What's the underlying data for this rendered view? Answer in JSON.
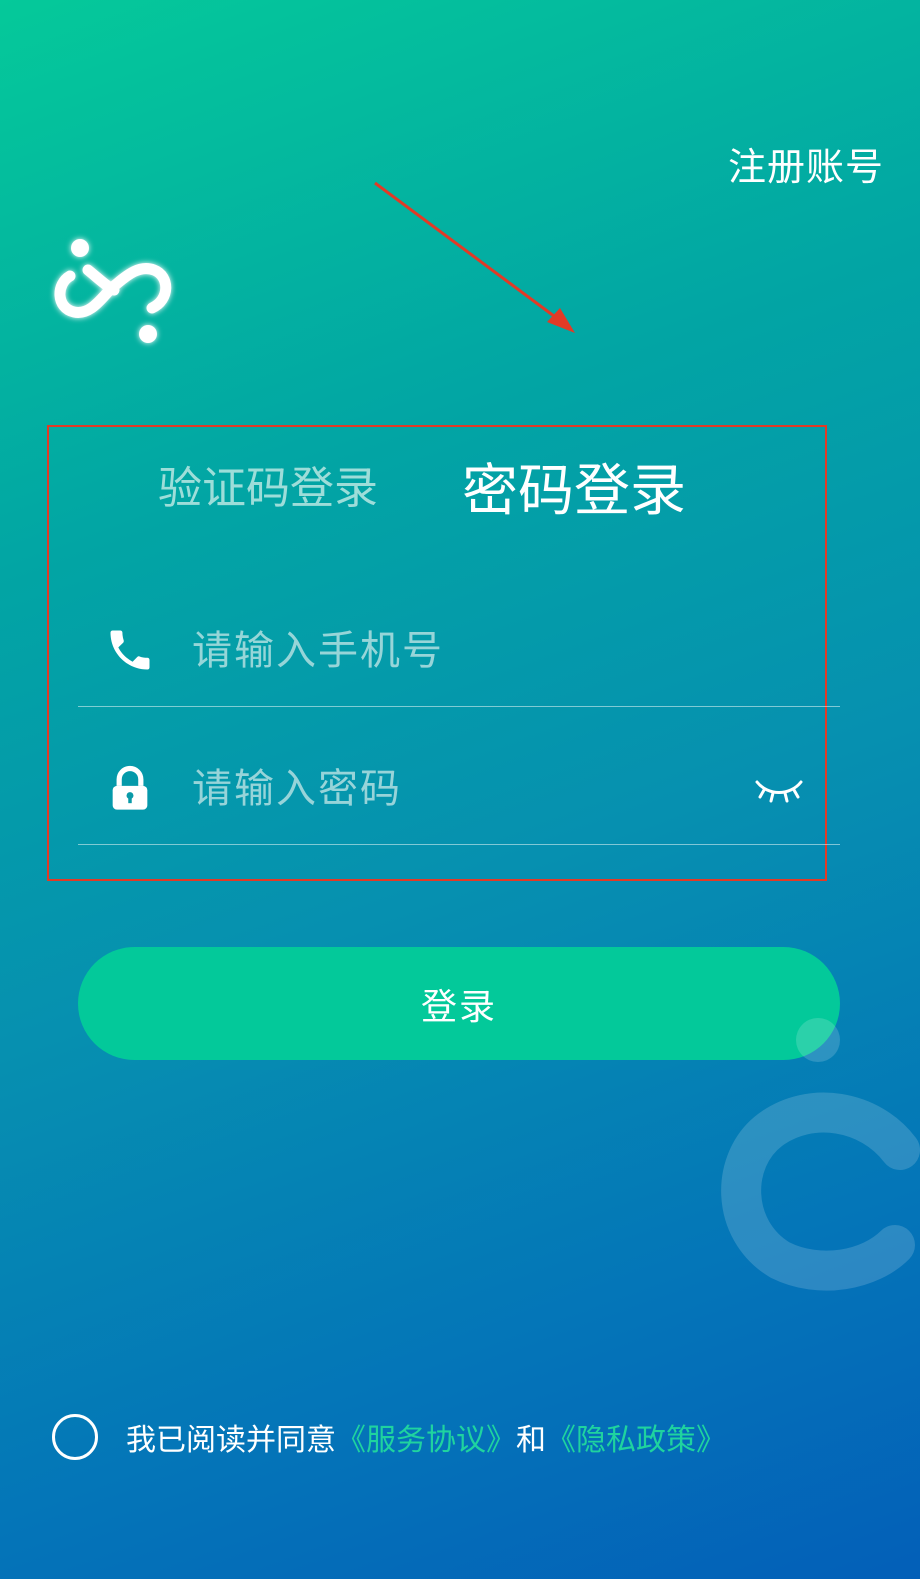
{
  "header": {
    "register_label": "注册账号"
  },
  "tabs": {
    "sms_login_label": "验证码登录",
    "password_login_label": "密码登录",
    "active": "password"
  },
  "form": {
    "phone_placeholder": "请输入手机号",
    "phone_value": "",
    "password_placeholder": "请输入密码",
    "password_value": "",
    "phone_icon": "phone-icon",
    "lock_icon": "lock-icon",
    "eye_icon": "eye-closed-icon"
  },
  "login_button": {
    "label": "登录"
  },
  "agreement": {
    "prefix": "我已阅读并同意",
    "service_link": "《服务协议》",
    "connector": "和",
    "privacy_link": "《隐私政策》",
    "checked": false
  },
  "colors": {
    "accent": "#03c99a",
    "link": "#1fd39f",
    "annotation": "#e23a26"
  }
}
